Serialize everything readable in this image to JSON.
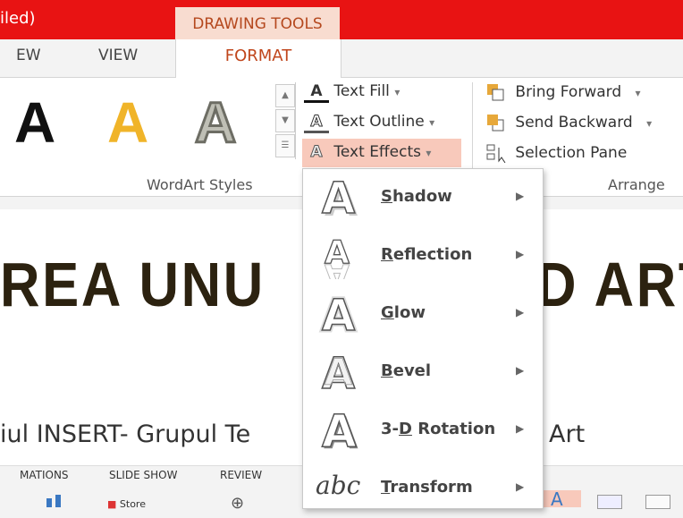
{
  "window": {
    "title_fragment": "iled)",
    "context_tab": "DRAWING TOOLS"
  },
  "tabs": {
    "view_fragment": "EW",
    "view": "VIEW",
    "format": "FORMAT"
  },
  "ribbon": {
    "gallery_letter": "A",
    "text_fill": "Text Fill",
    "text_outline": "Text Outline",
    "text_effects": "Text Effects",
    "wordart_styles_label": "WordArt Styles",
    "bring_forward": "Bring Forward",
    "send_backward": "Send Backward",
    "selection_pane": "Selection Pane",
    "arrange_label": "Arrange"
  },
  "slide": {
    "title_left": "REA UNU",
    "title_right": "D ART",
    "subtitle_left": "iul INSERT- Grupul Te",
    "subtitle_right": "Art"
  },
  "bottom_tabs": [
    "MATIONS",
    "SLIDE SHOW",
    "REVIEW"
  ],
  "bottom_partial_label": "Store",
  "dropdown": {
    "items": [
      {
        "prefix": "",
        "key": "S",
        "rest": "hadow"
      },
      {
        "prefix": "",
        "key": "R",
        "rest": "eflection"
      },
      {
        "prefix": "",
        "key": "G",
        "rest": "low"
      },
      {
        "prefix": "",
        "key": "B",
        "rest": "evel"
      },
      {
        "prefix": "3-",
        "key": "D",
        "rest": " Rotation"
      },
      {
        "prefix": "",
        "key": "T",
        "rest": "ransform"
      }
    ],
    "transform_icon_text": "abc"
  },
  "colors": {
    "title_bar": "#e81313",
    "accent": "#c0461c",
    "wordart_orange": "#f0b429",
    "highlight": "#f8c9bb"
  }
}
